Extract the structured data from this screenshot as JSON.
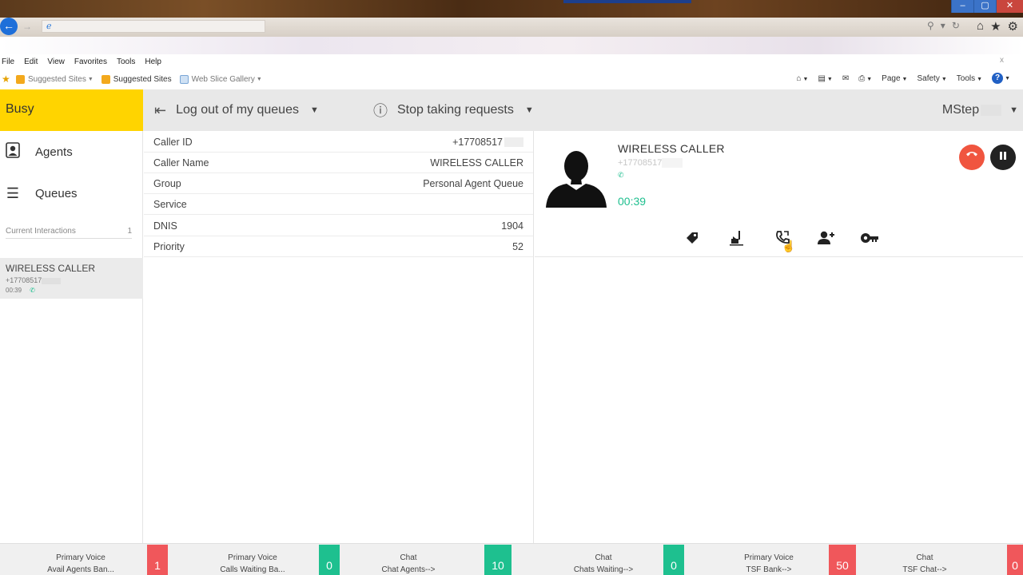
{
  "colors": {
    "status_busy": "#ffd400",
    "accent_green": "#1ec08f",
    "alert_red": "#f0575b",
    "hangup_red": "#f0553f"
  },
  "browser": {
    "menu": [
      "File",
      "Edit",
      "View",
      "Favorites",
      "Tools",
      "Help"
    ],
    "favorites": [
      "Suggested Sites",
      "Suggested Sites",
      "Web Slice Gallery"
    ],
    "command_bar": [
      "Page",
      "Safety",
      "Tools"
    ]
  },
  "header": {
    "status": "Busy",
    "logout_label": "Log out of my queues",
    "stop_label": "Stop taking requests",
    "user_name": "MStep"
  },
  "sidebar": {
    "agents_label": "Agents",
    "queues_label": "Queues",
    "current_interactions_label": "Current Interactions",
    "current_interactions_count": "1",
    "interaction": {
      "name": "WIRELESS CALLER",
      "number": "+17708517",
      "duration": "00:39"
    }
  },
  "caller_info": {
    "rows": [
      {
        "label": "Caller ID",
        "value": "+17708517"
      },
      {
        "label": "Caller Name",
        "value": "WIRELESS CALLER"
      },
      {
        "label": "Group",
        "value": "Personal Agent Queue"
      },
      {
        "label": "Service",
        "value": ""
      },
      {
        "label": "DNIS",
        "value": "1904"
      },
      {
        "label": "Priority",
        "value": "52"
      }
    ]
  },
  "call": {
    "name": "WIRELESS CALLER",
    "number": "+17708517",
    "timer": "00:39",
    "action_icons": [
      "tag-icon",
      "transfer-icon",
      "consult-call-icon",
      "add-participant-icon",
      "key-icon"
    ]
  },
  "stats": [
    {
      "line1": "Primary Voice",
      "line2": "Avail Agents Ban...",
      "count": "1",
      "color": "red"
    },
    {
      "line1": "Primary Voice",
      "line2": "Calls Waiting Ba...",
      "count": "0",
      "color": "green"
    },
    {
      "line1": "Chat",
      "line2": "Chat Agents-->",
      "count": "10",
      "color": "green"
    },
    {
      "line1": "Chat",
      "line2": "Chats Waiting-->",
      "count": "0",
      "color": "green"
    },
    {
      "line1": "Primary Voice",
      "line2": "TSF Bank-->",
      "count": "50",
      "color": "red"
    },
    {
      "line1": "Chat",
      "line2": "TSF Chat-->",
      "count": "0",
      "color": "red"
    }
  ]
}
